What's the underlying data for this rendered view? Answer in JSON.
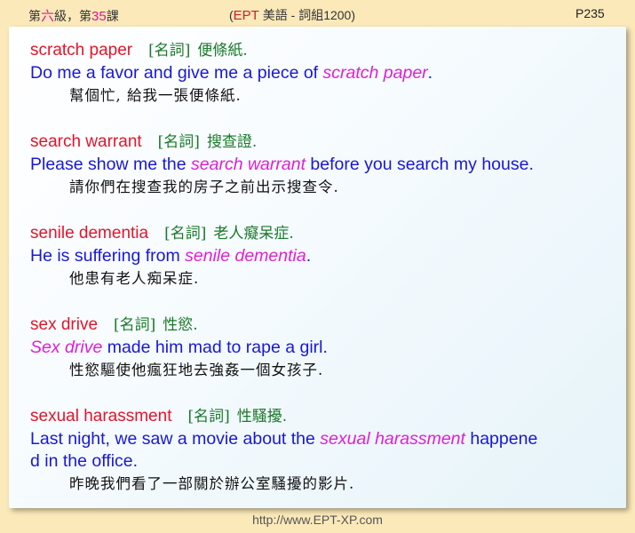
{
  "header": {
    "lesson_prefix": "第",
    "lesson_num1": "六",
    "lesson_mid": "級，第",
    "lesson_num2": "35",
    "lesson_suffix": "課",
    "center_open": "(",
    "center_ept": "EPT",
    "center_rest": " 美語 - 詞組1200)",
    "page": "P235"
  },
  "entries": [
    {
      "term": "scratch paper",
      "pos": "[名詞]",
      "meaning": "便條紙.",
      "en": [
        "Do me a favor and give me a piece of ",
        "scratch paper",
        "."
      ],
      "zh": "幫個忙, 給我一張便條紙."
    },
    {
      "term": "search warrant",
      "pos": "[名詞]",
      "meaning": "搜查證.",
      "en": [
        "Please show me the ",
        "search warrant",
        " before you search my house."
      ],
      "zh": "請你們在搜查我的房子之前出示搜查令."
    },
    {
      "term": "senile dementia",
      "pos": "[名詞]",
      "meaning": "老人癡呆症.",
      "en": [
        "He is suffering from ",
        "senile dementia",
        "."
      ],
      "zh": "他患有老人痴呆症."
    },
    {
      "term": "sex drive",
      "pos": "[名詞]",
      "meaning": "性慾.",
      "en": [
        "",
        "Sex drive",
        " made him mad to rape a girl."
      ],
      "zh": "性慾驅使他瘋狂地去強姦一個女孩子."
    },
    {
      "term": "sexual harassment",
      "pos": "[名詞]",
      "meaning": "性騷擾.",
      "en": [
        "Last night, we saw a movie about the ",
        "sexual harassment",
        " happene",
        "d in the office."
      ],
      "zh": "昨晚我們看了一部關於辦公室騷擾的影片."
    }
  ],
  "footer": "http://www.EPT-XP.com"
}
